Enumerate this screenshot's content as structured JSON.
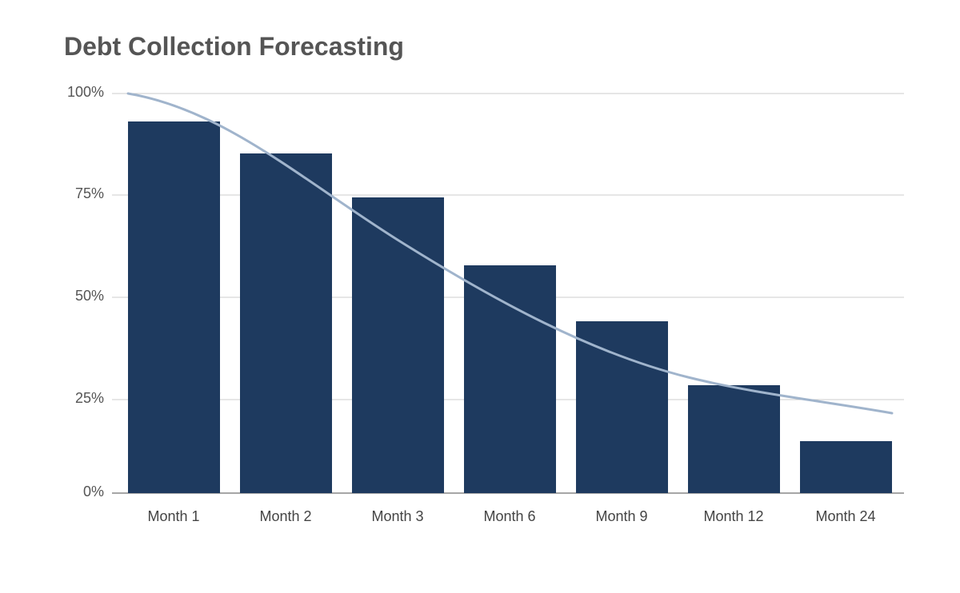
{
  "title": "Debt Collection Forecasting",
  "chart": {
    "yAxis": {
      "labels": [
        "100%",
        "75%",
        "50%",
        "25%",
        "0%"
      ],
      "gridLines": [
        0,
        25,
        50,
        75,
        100
      ]
    },
    "bars": [
      {
        "label": "Month 1",
        "value": 93
      },
      {
        "label": "Month 2",
        "value": 85
      },
      {
        "label": "Month 3",
        "value": 74
      },
      {
        "label": "Month 6",
        "value": 57
      },
      {
        "label": "Month 9",
        "value": 43
      },
      {
        "label": "Month 12",
        "value": 27
      },
      {
        "label": "Month 24",
        "value": 13
      }
    ],
    "barColor": "#1e3a5f",
    "curveColor": "#a0aec0"
  }
}
